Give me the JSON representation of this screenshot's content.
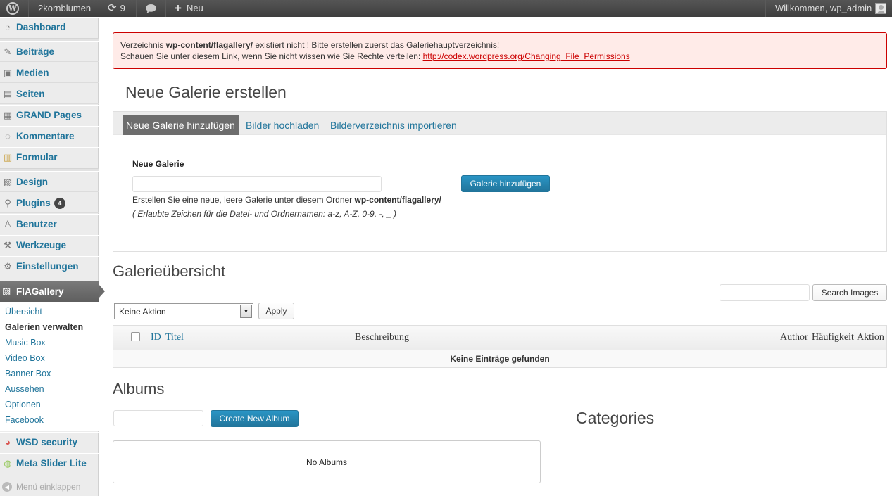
{
  "adminbar": {
    "logo": "W",
    "site_name": "2kornblumen",
    "updates_count": "9",
    "new_label": "Neu",
    "greeting": "Willkommen, wp_admin"
  },
  "sidebar": {
    "items": [
      {
        "label": "Dashboard",
        "icon": "dashboard-icon"
      },
      {
        "label": "Beiträge",
        "icon": "pin-icon"
      },
      {
        "label": "Medien",
        "icon": "media-icon"
      },
      {
        "label": "Seiten",
        "icon": "pages-icon"
      },
      {
        "label": "GRAND Pages",
        "icon": "grand-pages-icon"
      },
      {
        "label": "Kommentare",
        "icon": "comment-icon"
      },
      {
        "label": "Formular",
        "icon": "form-icon"
      },
      {
        "label": "Design",
        "icon": "design-icon"
      },
      {
        "label": "Plugins",
        "icon": "plugin-icon",
        "badge": "4"
      },
      {
        "label": "Benutzer",
        "icon": "users-icon"
      },
      {
        "label": "Werkzeuge",
        "icon": "tools-icon"
      },
      {
        "label": "Einstellungen",
        "icon": "settings-icon"
      }
    ],
    "active": {
      "label": "FlAGallery",
      "icon": "gallery-icon"
    },
    "submenu": [
      "Übersicht",
      "Galerien verwalten",
      "Music Box",
      "Video Box",
      "Banner Box",
      "Aussehen",
      "Optionen",
      "Facebook"
    ],
    "bottom_items": [
      {
        "label": "WSD security",
        "icon": "security-icon"
      },
      {
        "label": "Meta Slider Lite",
        "icon": "slider-icon"
      }
    ],
    "collapse_label": "Menü einklappen"
  },
  "notice": {
    "line1_pre": "Verzeichnis ",
    "line1_bold": "wp-content/flagallery/",
    "line1_post": " existiert nicht ! Bitte erstellen zuerst das Galeriehauptverzeichnis!",
    "line2_pre": "Schauen Sie unter diesem Link, wenn Sie nicht wissen wie Sie Rechte verteilen: ",
    "line2_link": "http://codex.wordpress.org/Changing_File_Permissions"
  },
  "new_gallery": {
    "title": "Neue Galerie erstellen",
    "tabs": [
      "Neue Galerie hinzufügen",
      "Bilder hochladen",
      "Bilderverzeichnis importieren"
    ],
    "field_label": "Neue Galerie",
    "input_value": "",
    "button_label": "Galerie hinzufügen",
    "hint_pre": "Erstellen Sie eine neue, leere Galerie unter diesem Ordner ",
    "hint_bold": "wp-content/flagallery/",
    "hint_allowed": "( Erlaubte Zeichen für die Datei- und Ordnernamen: a-z, A-Z, 0-9, -, _ )"
  },
  "overview": {
    "title": "Galerieübersicht",
    "search_value": "",
    "search_button": "Search Images",
    "bulk_select": "Keine Aktion",
    "apply_button": "Apply",
    "columns": {
      "id": "ID",
      "title": "Titel",
      "description": "Beschreibung",
      "author": "Author",
      "frequency": "Häufigkeit",
      "action": "Aktion"
    },
    "empty_message": "Keine Einträge gefunden"
  },
  "albums": {
    "title": "Albums",
    "input_value": "",
    "create_button": "Create New Album",
    "empty_message": "No Albums",
    "categories_title": "Categories"
  }
}
